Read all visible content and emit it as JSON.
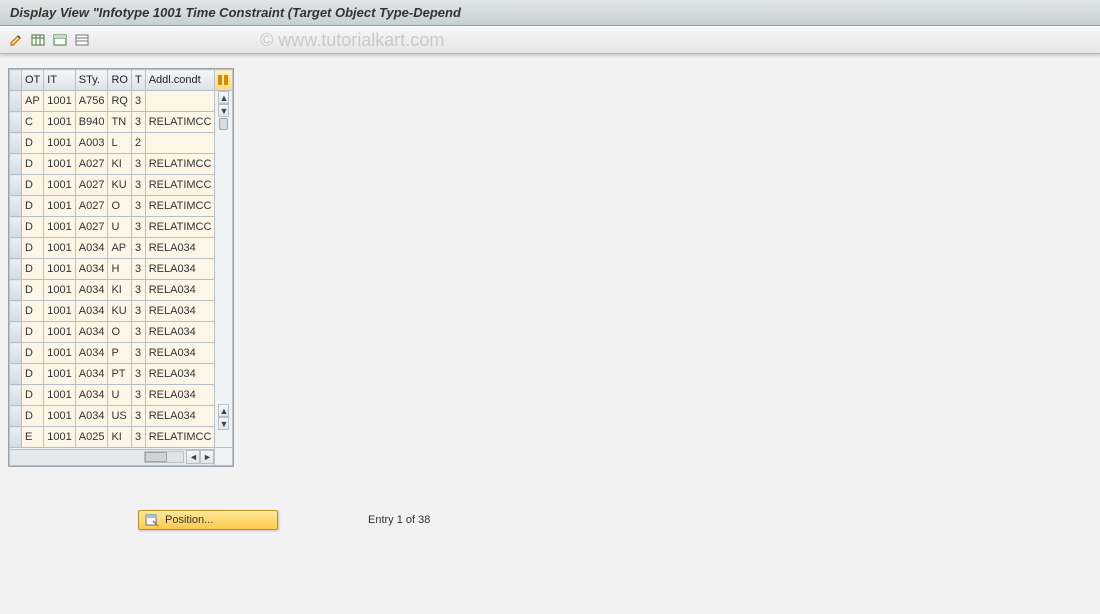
{
  "title": "Display View \"Infotype 1001 Time Constraint (Target Object Type-Depend",
  "watermark": "© www.tutorialkart.com",
  "toolbar": {
    "edit": "Change",
    "tbl1": "Table",
    "tbl2": "Table",
    "tbl3": "Table"
  },
  "columns": [
    "OT",
    "IT",
    "STy.",
    "RO",
    "T",
    "Addl.condt"
  ],
  "rows": [
    {
      "ot": "AP",
      "it": "1001",
      "sty": "A756",
      "ro": "RQ",
      "t": "3",
      "addl": ""
    },
    {
      "ot": "C",
      "it": "1001",
      "sty": "B940",
      "ro": "TN",
      "t": "3",
      "addl": "RELATIMCC"
    },
    {
      "ot": "D",
      "it": "1001",
      "sty": "A003",
      "ro": "L",
      "t": "2",
      "addl": ""
    },
    {
      "ot": "D",
      "it": "1001",
      "sty": "A027",
      "ro": "KI",
      "t": "3",
      "addl": "RELATIMCC"
    },
    {
      "ot": "D",
      "it": "1001",
      "sty": "A027",
      "ro": "KU",
      "t": "3",
      "addl": "RELATIMCC"
    },
    {
      "ot": "D",
      "it": "1001",
      "sty": "A027",
      "ro": "O",
      "t": "3",
      "addl": "RELATIMCC"
    },
    {
      "ot": "D",
      "it": "1001",
      "sty": "A027",
      "ro": "U",
      "t": "3",
      "addl": "RELATIMCC"
    },
    {
      "ot": "D",
      "it": "1001",
      "sty": "A034",
      "ro": "AP",
      "t": "3",
      "addl": "RELA034"
    },
    {
      "ot": "D",
      "it": "1001",
      "sty": "A034",
      "ro": "H",
      "t": "3",
      "addl": "RELA034"
    },
    {
      "ot": "D",
      "it": "1001",
      "sty": "A034",
      "ro": "KI",
      "t": "3",
      "addl": "RELA034"
    },
    {
      "ot": "D",
      "it": "1001",
      "sty": "A034",
      "ro": "KU",
      "t": "3",
      "addl": "RELA034"
    },
    {
      "ot": "D",
      "it": "1001",
      "sty": "A034",
      "ro": "O",
      "t": "3",
      "addl": "RELA034"
    },
    {
      "ot": "D",
      "it": "1001",
      "sty": "A034",
      "ro": "P",
      "t": "3",
      "addl": "RELA034"
    },
    {
      "ot": "D",
      "it": "1001",
      "sty": "A034",
      "ro": "PT",
      "t": "3",
      "addl": "RELA034"
    },
    {
      "ot": "D",
      "it": "1001",
      "sty": "A034",
      "ro": "U",
      "t": "3",
      "addl": "RELA034"
    },
    {
      "ot": "D",
      "it": "1001",
      "sty": "A034",
      "ro": "US",
      "t": "3",
      "addl": "RELA034"
    },
    {
      "ot": "E",
      "it": "1001",
      "sty": "A025",
      "ro": "KI",
      "t": "3",
      "addl": "RELATIMCC"
    }
  ],
  "footer": {
    "position_label": "Position...",
    "entry_text": "Entry 1 of 38"
  }
}
